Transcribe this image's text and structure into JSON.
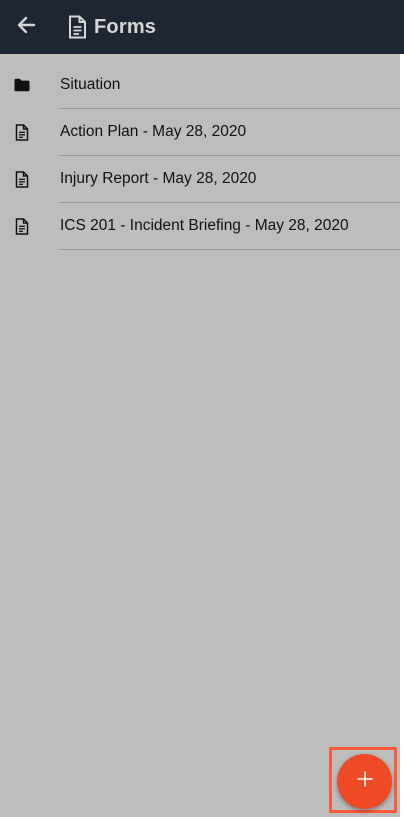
{
  "header": {
    "title": "Forms",
    "back_icon": "arrow-left-icon",
    "title_icon": "document-icon",
    "background": "#1f2633"
  },
  "items": [
    {
      "label": "Situation",
      "icon": "folder-icon"
    },
    {
      "label": "Action Plan - May 28, 2020",
      "icon": "document-icon"
    },
    {
      "label": "Injury Report - May 28, 2020",
      "icon": "document-icon"
    },
    {
      "label": "ICS 201 - Incident Briefing - May 28, 2020",
      "icon": "document-icon"
    }
  ],
  "fab": {
    "icon": "plus-icon",
    "color": "#ee4a26",
    "highlight_color": "#ff5a36"
  }
}
